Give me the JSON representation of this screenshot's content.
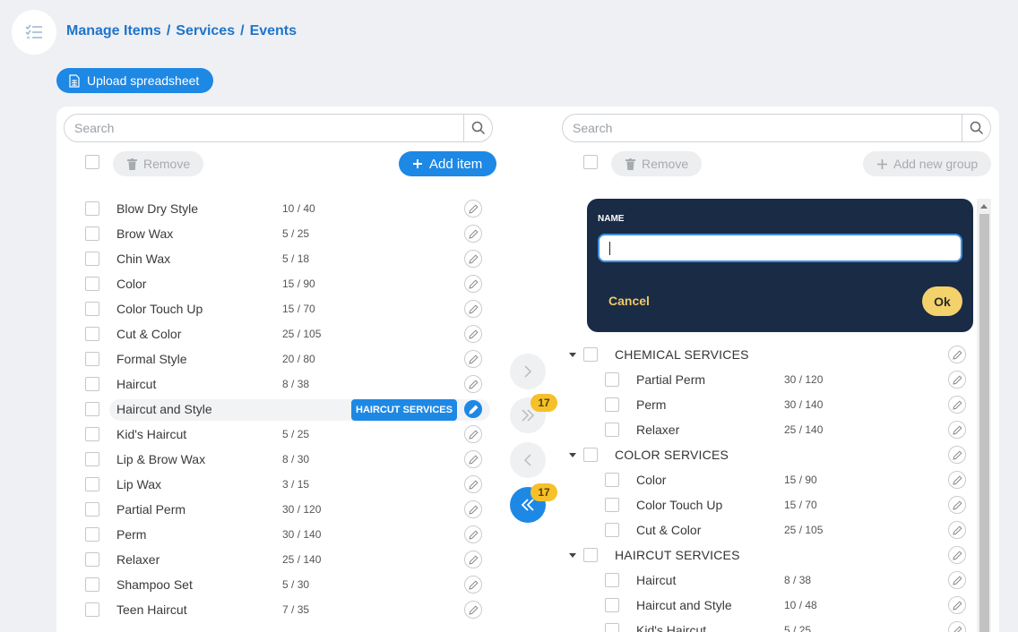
{
  "breadcrumb": [
    "Manage Items",
    "Services",
    "Events"
  ],
  "breadcrumb_sep": "/",
  "upload_label": "Upload spreadsheet",
  "left": {
    "search_placeholder": "Search",
    "remove_label": "Remove",
    "add_label": "Add item",
    "items": [
      {
        "name": "Blow Dry Style",
        "a": "10",
        "b": "40"
      },
      {
        "name": "Brow Wax",
        "a": "5",
        "b": "25"
      },
      {
        "name": "Chin Wax",
        "a": "5",
        "b": "18"
      },
      {
        "name": "Color",
        "a": "15",
        "b": "90"
      },
      {
        "name": "Color Touch Up",
        "a": "15",
        "b": "70"
      },
      {
        "name": "Cut & Color",
        "a": "25",
        "b": "105"
      },
      {
        "name": "Formal Style",
        "a": "20",
        "b": "80"
      },
      {
        "name": "Haircut",
        "a": "8",
        "b": "38"
      },
      {
        "name": "Haircut and Style",
        "a": "",
        "b": "",
        "tag": "HAIRCUT SERVICES",
        "highlight": true
      },
      {
        "name": "Kid's Haircut",
        "a": "5",
        "b": "25"
      },
      {
        "name": "Lip & Brow Wax",
        "a": "8",
        "b": "30"
      },
      {
        "name": "Lip Wax",
        "a": "3",
        "b": "15"
      },
      {
        "name": "Partial Perm",
        "a": "30",
        "b": "120"
      },
      {
        "name": "Perm",
        "a": "30",
        "b": "140"
      },
      {
        "name": "Relaxer",
        "a": "25",
        "b": "140"
      },
      {
        "name": "Shampoo Set",
        "a": "5",
        "b": "30"
      },
      {
        "name": "Teen Haircut",
        "a": "7",
        "b": "35"
      }
    ]
  },
  "transfer": {
    "badge_all_right": "17",
    "badge_all_left": "17"
  },
  "right": {
    "search_placeholder": "Search",
    "remove_label": "Remove",
    "add_group_label": "Add new group",
    "groups": [
      {
        "name": "CHEMICAL SERVICES",
        "items": [
          {
            "name": "Partial Perm",
            "a": "30",
            "b": "120"
          },
          {
            "name": "Perm",
            "a": "30",
            "b": "140"
          },
          {
            "name": "Relaxer",
            "a": "25",
            "b": "140"
          }
        ]
      },
      {
        "name": "COLOR SERVICES",
        "items": [
          {
            "name": "Color",
            "a": "15",
            "b": "90"
          },
          {
            "name": "Color Touch Up",
            "a": "15",
            "b": "70"
          },
          {
            "name": "Cut & Color",
            "a": "25",
            "b": "105"
          }
        ]
      },
      {
        "name": "HAIRCUT SERVICES",
        "items": [
          {
            "name": "Haircut",
            "a": "8",
            "b": "38"
          },
          {
            "name": "Haircut and Style",
            "a": "10",
            "b": "48"
          },
          {
            "name": "Kid's Haircut",
            "a": "5",
            "b": "25"
          }
        ]
      }
    ]
  },
  "popup": {
    "label": "NAME",
    "value": "",
    "cancel_label": "Cancel",
    "ok_label": "Ok"
  },
  "colors": {
    "primary": "#1e88e5",
    "popup_bg": "#1a2b46",
    "badge": "#f5c02a",
    "accent": "#f3d26b"
  }
}
